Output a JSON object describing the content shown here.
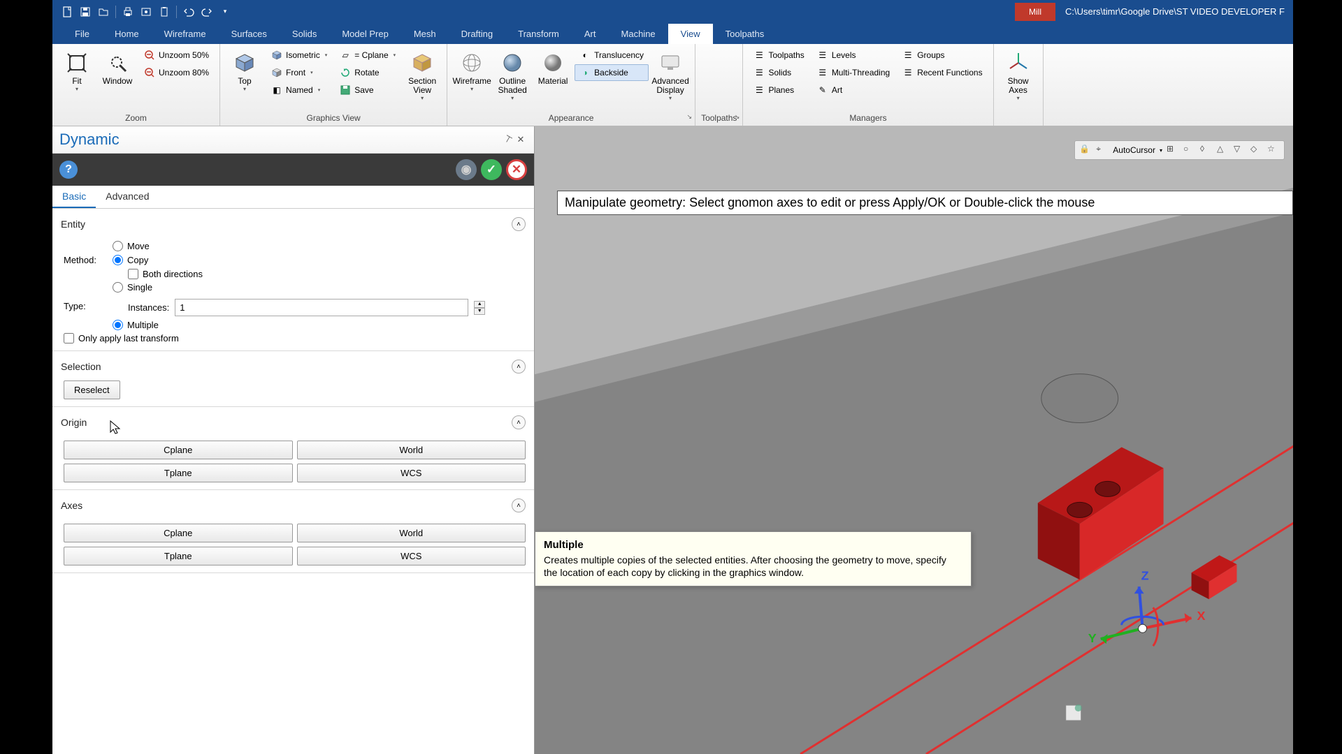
{
  "titlebar": {
    "doctype": "Mill",
    "filepath": "C:\\Users\\timr\\Google Drive\\ST VIDEO DEVELOPER F"
  },
  "ribbon": {
    "tabs": [
      "File",
      "Home",
      "Wireframe",
      "Surfaces",
      "Solids",
      "Model Prep",
      "Mesh",
      "Drafting",
      "Transform",
      "Art",
      "Machine",
      "View",
      "Toolpaths"
    ],
    "active_tab": "View",
    "groups": {
      "zoom": {
        "label": "Zoom",
        "fit": "Fit",
        "window": "Window",
        "unzoom50": "Unzoom 50%",
        "unzoom80": "Unzoom 80%"
      },
      "graphics": {
        "label": "Graphics View",
        "top": "Top",
        "isometric": "Isometric",
        "front": "Front",
        "named": "Named",
        "cplane": "= Cplane",
        "rotate": "Rotate",
        "save": "Save",
        "section": "Section View"
      },
      "appearance": {
        "label": "Appearance",
        "wireframe": "Wireframe",
        "outline_shaded": "Outline Shaded",
        "material": "Material",
        "translucency": "Translucency",
        "backside": "Backside",
        "advanced_display": "Advanced Display"
      },
      "toolpaths": {
        "label": "Toolpaths"
      },
      "managers": {
        "label": "Managers",
        "toolpaths": "Toolpaths",
        "solids": "Solids",
        "planes": "Planes",
        "levels": "Levels",
        "multithreading": "Multi-Threading",
        "art": "Art",
        "groups": "Groups",
        "recent": "Recent Functions"
      },
      "axes": {
        "show_axes": "Show Axes"
      }
    }
  },
  "panel": {
    "title": "Dynamic",
    "tabs": {
      "basic": "Basic",
      "advanced": "Advanced",
      "active": "Basic"
    },
    "entity": {
      "header": "Entity",
      "method_label": "Method:",
      "move": "Move",
      "copy": "Copy",
      "both_directions": "Both directions",
      "type_label": "Type:",
      "single": "Single",
      "instances_label": "Instances:",
      "instances_value": "1",
      "multiple": "Multiple",
      "only_last": "Only apply last transform",
      "selected_method": "Copy",
      "selected_type": "Multiple",
      "both_directions_checked": false,
      "only_last_checked": false
    },
    "selection": {
      "header": "Selection",
      "reselect": "Reselect"
    },
    "origin": {
      "header": "Origin",
      "cplane": "Cplane",
      "world": "World",
      "tplane": "Tplane",
      "wcs": "WCS"
    },
    "axes": {
      "header": "Axes",
      "cplane": "Cplane",
      "world": "World",
      "tplane": "Tplane",
      "wcs": "WCS"
    }
  },
  "viewport": {
    "prompt": "Manipulate geometry: Select gnomon axes to edit or press Apply/OK or Double-click the mouse",
    "autocursor": "AutoCursor",
    "gnomon": {
      "x": "X",
      "y": "Y",
      "z": "Z"
    }
  },
  "tooltip": {
    "title": "Multiple",
    "body": "Creates multiple copies of the selected entities. After choosing the geometry to move, specify the location of each copy by clicking in the graphics window."
  }
}
